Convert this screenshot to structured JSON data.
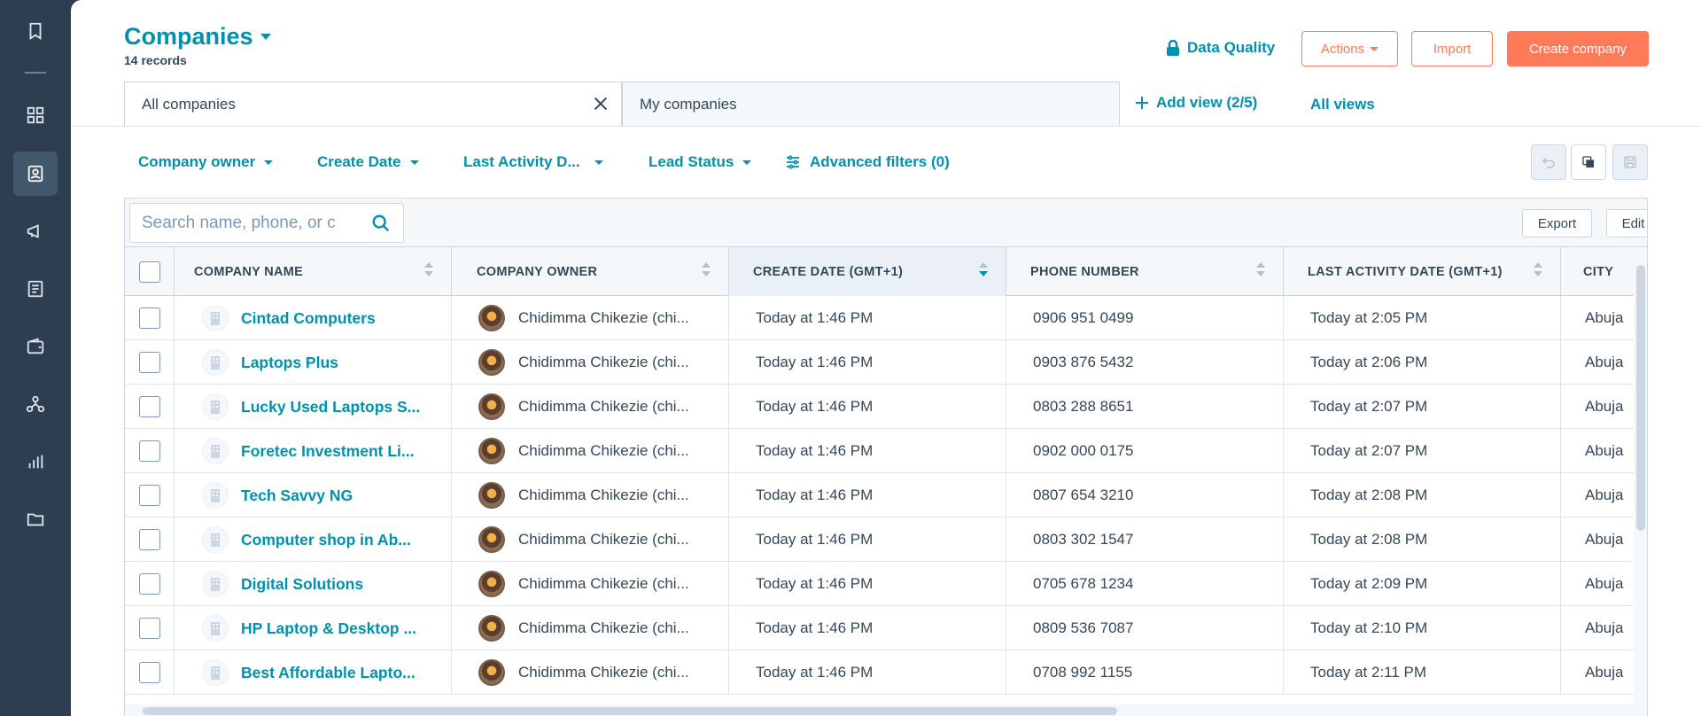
{
  "sidebar": {
    "items": [
      {
        "icon": "bookmark-icon"
      },
      {
        "icon": "grid-icon"
      },
      {
        "icon": "contacts-icon"
      },
      {
        "icon": "megaphone-icon"
      },
      {
        "icon": "document-icon"
      },
      {
        "icon": "wallet-icon"
      },
      {
        "icon": "network-icon"
      },
      {
        "icon": "bar-chart-icon"
      },
      {
        "icon": "folder-icon"
      }
    ]
  },
  "header": {
    "title": "Companies",
    "records": "14 records",
    "data_quality": "Data Quality",
    "actions": "Actions",
    "import": "Import",
    "create": "Create company"
  },
  "views": {
    "tabs": [
      {
        "label": "All companies",
        "active": true
      },
      {
        "label": "My companies",
        "active": false
      }
    ],
    "add_view": "Add view (2/5)",
    "all_views": "All views"
  },
  "filters": {
    "items": [
      "Company owner",
      "Create Date",
      "Last Activity D...",
      "Lead Status"
    ],
    "advanced": "Advanced filters (0)"
  },
  "toolbar": {
    "search_placeholder": "Search name, phone, or c",
    "export": "Export",
    "edit_columns": "Edit columns"
  },
  "table": {
    "columns": [
      "COMPANY NAME",
      "COMPANY OWNER",
      "CREATE DATE (GMT+1)",
      "PHONE NUMBER",
      "LAST ACTIVITY DATE (GMT+1)",
      "CITY"
    ],
    "sorted_column": "CREATE DATE (GMT+1)",
    "rows": [
      {
        "name": "Cintad Computers",
        "owner": "Chidimma Chikezie (chi...",
        "create": "Today at 1:46 PM",
        "phone": "0906 951 0499",
        "last": "Today at 2:05 PM",
        "city": "Abuja"
      },
      {
        "name": "Laptops Plus",
        "owner": "Chidimma Chikezie (chi...",
        "create": "Today at 1:46 PM",
        "phone": "0903 876 5432",
        "last": "Today at 2:06 PM",
        "city": "Abuja"
      },
      {
        "name": "Lucky Used Laptops S...",
        "owner": "Chidimma Chikezie (chi...",
        "create": "Today at 1:46 PM",
        "phone": "0803 288 8651",
        "last": "Today at 2:07 PM",
        "city": "Abuja"
      },
      {
        "name": "Foretec Investment Li...",
        "owner": "Chidimma Chikezie (chi...",
        "create": "Today at 1:46 PM",
        "phone": "0902 000 0175",
        "last": "Today at 2:07 PM",
        "city": "Abuja"
      },
      {
        "name": "Tech Savvy NG",
        "owner": "Chidimma Chikezie (chi...",
        "create": "Today at 1:46 PM",
        "phone": "0807 654 3210",
        "last": "Today at 2:08 PM",
        "city": "Abuja"
      },
      {
        "name": "Computer shop in Ab...",
        "owner": "Chidimma Chikezie (chi...",
        "create": "Today at 1:46 PM",
        "phone": "0803 302 1547",
        "last": "Today at 2:08 PM",
        "city": "Abuja"
      },
      {
        "name": "Digital Solutions",
        "owner": "Chidimma Chikezie (chi...",
        "create": "Today at 1:46 PM",
        "phone": "0705 678 1234",
        "last": "Today at 2:09 PM",
        "city": "Abuja"
      },
      {
        "name": "HP Laptop & Desktop ...",
        "owner": "Chidimma Chikezie (chi...",
        "create": "Today at 1:46 PM",
        "phone": "0809 536 7087",
        "last": "Today at 2:10 PM",
        "city": "Abuja"
      },
      {
        "name": "Best Affordable Lapto...",
        "owner": "Chidimma Chikezie (chi...",
        "create": "Today at 1:46 PM",
        "phone": "0708 992 1155",
        "last": "Today at 2:11 PM",
        "city": "Abuja"
      }
    ]
  },
  "colors": {
    "sidebar": "#2d3e50",
    "accent": "#0091ae",
    "orange": "#ff7a59",
    "border": "#cbd6e2"
  }
}
